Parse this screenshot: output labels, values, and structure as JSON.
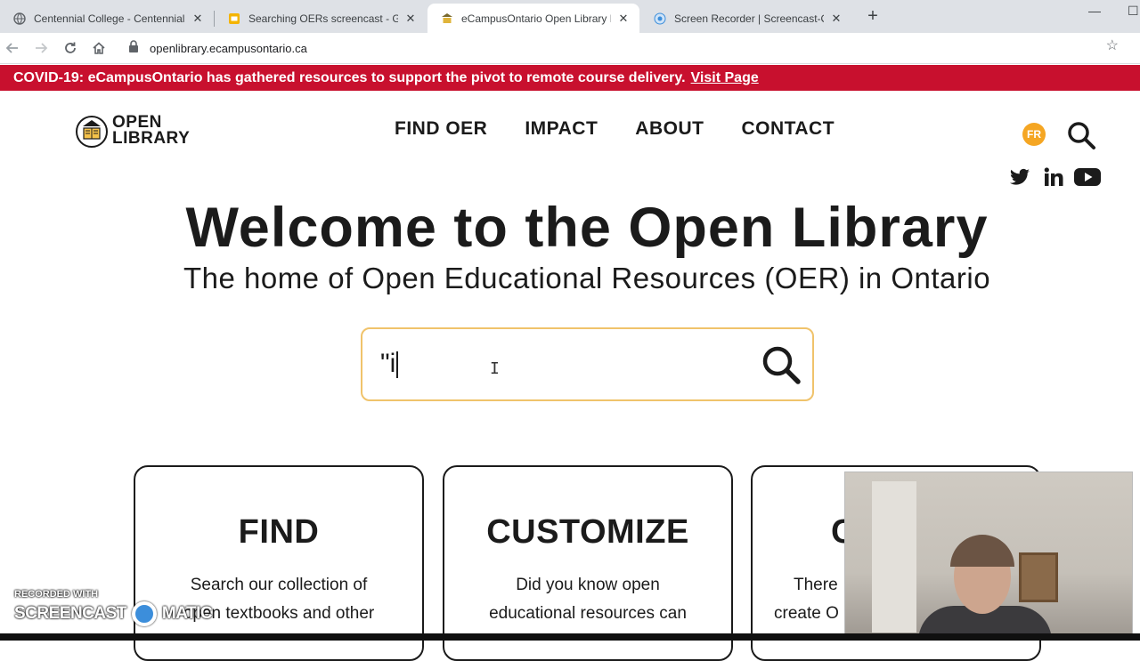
{
  "browser": {
    "tabs": [
      {
        "title": "Centennial College - Centennial",
        "active": false
      },
      {
        "title": "Searching OERs screencast - Goo",
        "active": false
      },
      {
        "title": "eCampusOntario Open Library Po",
        "active": true
      },
      {
        "title": "Screen Recorder | Screencast-O-",
        "active": false
      }
    ],
    "url": "openlibrary.ecampusontario.ca",
    "new_tab": "+",
    "minimize": "—",
    "maximize": "☐"
  },
  "banner": {
    "text": "COVID-19: eCampusOntario has gathered resources to support the pivot to remote course delivery.",
    "link": "Visit Page"
  },
  "logo": {
    "line1": "OPEN",
    "line2": "LIBRARY"
  },
  "nav": [
    "FIND OER",
    "IMPACT",
    "ABOUT",
    "CONTACT"
  ],
  "lang": "FR",
  "hero": {
    "title": "Welcome to the Open Library",
    "subtitle": "The home of Open Educational Resources (OER) in Ontario"
  },
  "search": {
    "value": "\"i"
  },
  "cards": [
    {
      "title": "FIND",
      "line1": "Search our collection of",
      "line2": "open textbooks and other"
    },
    {
      "title": "CUSTOMIZE",
      "line1": "Did you know open",
      "line2": "educational resources can"
    },
    {
      "title": "C",
      "line1": "There",
      "line2": "create O"
    }
  ],
  "watermark": {
    "small": "RECORDED WITH",
    "left": "SCREENCAST",
    "right": "MATIC"
  },
  "colors": {
    "banner": "#c8102e",
    "fr_badge": "#f5a623",
    "search_border": "#f0c36b"
  }
}
